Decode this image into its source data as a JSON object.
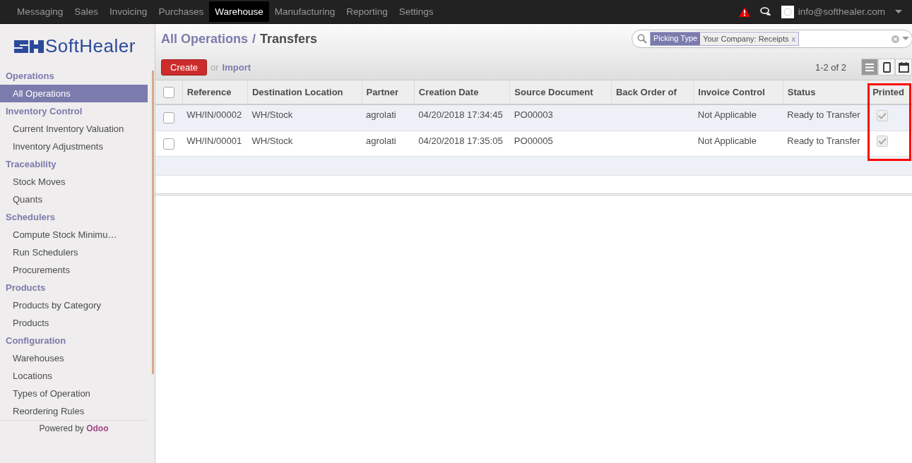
{
  "top_menu": [
    {
      "label": "Messaging",
      "selected": false
    },
    {
      "label": "Sales",
      "selected": false
    },
    {
      "label": "Invoicing",
      "selected": false
    },
    {
      "label": "Purchases",
      "selected": false
    },
    {
      "label": "Warehouse",
      "selected": true
    },
    {
      "label": "Manufacturing",
      "selected": false
    },
    {
      "label": "Reporting",
      "selected": false
    },
    {
      "label": "Settings",
      "selected": false
    }
  ],
  "user": {
    "email": "info@softhealer.com"
  },
  "logo": {
    "text": "SoftHealer"
  },
  "sidebar": [
    {
      "header": "Operations",
      "items": [
        {
          "label": "All Operations",
          "selected": true
        }
      ]
    },
    {
      "header": "Inventory Control",
      "items": [
        {
          "label": "Current Inventory Valuation",
          "selected": false
        },
        {
          "label": "Inventory Adjustments",
          "selected": false
        }
      ]
    },
    {
      "header": "Traceability",
      "items": [
        {
          "label": "Stock Moves",
          "selected": false
        },
        {
          "label": "Quants",
          "selected": false
        }
      ]
    },
    {
      "header": "Schedulers",
      "items": [
        {
          "label": "Compute Stock Minimu…",
          "selected": false
        },
        {
          "label": "Run Schedulers",
          "selected": false
        },
        {
          "label": "Procurements",
          "selected": false
        }
      ]
    },
    {
      "header": "Products",
      "items": [
        {
          "label": "Products by Category",
          "selected": false
        },
        {
          "label": "Products",
          "selected": false
        }
      ]
    },
    {
      "header": "Configuration",
      "items": [
        {
          "label": "Warehouses",
          "selected": false
        },
        {
          "label": "Locations",
          "selected": false
        },
        {
          "label": "Types of Operation",
          "selected": false
        },
        {
          "label": "Reordering Rules",
          "selected": false
        }
      ]
    }
  ],
  "powered_by": {
    "text": "Powered by",
    "brand": "Odoo"
  },
  "breadcrumb": [
    {
      "label": "All Operations"
    },
    {
      "label": "Transfers"
    }
  ],
  "breadcrumb_separator": "/",
  "search": {
    "facet_label": "Picking Type",
    "facet_value": "Your Company: Receipts",
    "remove": "x"
  },
  "actions": {
    "create": "Create",
    "or": "or",
    "import": "Import"
  },
  "pager": "1-2 of 2",
  "views": [
    {
      "kind": "list",
      "selected": true
    },
    {
      "kind": "form",
      "selected": false
    },
    {
      "kind": "calendar",
      "selected": false
    }
  ],
  "table": {
    "select_all": false,
    "columns": [
      {
        "label": "Reference",
        "highlighted": false
      },
      {
        "label": "Destination Location",
        "highlighted": false
      },
      {
        "label": "Partner",
        "highlighted": false
      },
      {
        "label": "Creation Date",
        "highlighted": false
      },
      {
        "label": "Source Document",
        "highlighted": false
      },
      {
        "label": "Back Order of",
        "highlighted": false
      },
      {
        "label": "Invoice Control",
        "highlighted": false
      },
      {
        "label": "Status",
        "highlighted": false
      },
      {
        "label": "Printed",
        "highlighted": true
      }
    ],
    "rows": [
      {
        "checked": false,
        "printed": true,
        "cells": [
          "WH/IN/00002",
          "WH/Stock",
          "agrolati",
          "04/20/2018 17:34:45",
          "PO00003",
          "",
          "Not Applicable",
          "Ready to Transfer"
        ]
      },
      {
        "checked": false,
        "printed": true,
        "cells": [
          "WH/IN/00001",
          "WH/Stock",
          "agrolati",
          "04/20/2018 17:35:05",
          "PO00005",
          "",
          "Not Applicable",
          "Ready to Transfer"
        ]
      }
    ]
  }
}
